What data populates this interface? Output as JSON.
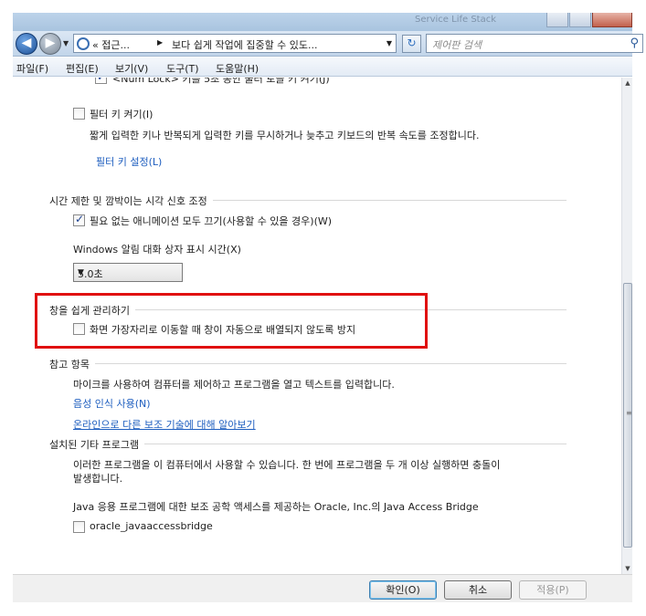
{
  "titlebar": {
    "title": "Service Life Stack"
  },
  "nav": {
    "back_icon": "back-arrow-icon",
    "forward_icon": "forward-arrow-icon",
    "address": {
      "crumb_1": "« 접근...",
      "crumb_2": "보다 쉽게 작업에 집중할 수 있도...",
      "separator": "▶",
      "dropdown": "▼"
    },
    "refresh_glyph": "↻",
    "search_placeholder": "제어판 검색",
    "search_icon_glyph": "⚲"
  },
  "menu": [
    "파일(F)",
    "편집(E)",
    "보기(V)",
    "도구(T)",
    "도움말(H)"
  ],
  "content": {
    "cut_item": "<Num Lock> 키를 5초 동안 눌러 토글 키 켜기(J)",
    "filter_keys": {
      "label": "필터 키 켜기(I)",
      "checked": false,
      "description": "짧게 입력한 키나 반복되게 입력한 키를 무시하거나 늦추고 키보드의 반복 속도를 조정합니다.",
      "settings_link": "필터 키 설정(L)"
    },
    "timing_section": {
      "title": "시간 제한 및 깜박이는 시각 신호 조정",
      "animations_label": "필요 없는 애니메이션 모두 끄기(사용할 수 있을 경우)(W)",
      "animations_checked": true,
      "notify_label": "Windows 알림 대화 상자 표시 시간(X)",
      "notify_value": "5.0초"
    },
    "window_section": {
      "title": "창을 쉽게 관리하기",
      "snap_label": "화면 가장자리로 이동할 때 창이 자동으로 배열되지 않도록 방지",
      "snap_checked": false
    },
    "see_also": {
      "title": "참고 항목",
      "description": "마이크를 사용하여 컴퓨터를 제어하고 프로그램을 열고 텍스트를 입력합니다.",
      "speech_link": "음성 인식 사용(N)",
      "online_link": "온라인으로 다른 보조 기술에 대해 알아보기"
    },
    "installed": {
      "title": "설치된 기타 프로그램",
      "description_1": "이러한 프로그램을 이 컴퓨터에서 사용할 수 있습니다. 한 번에 프로그램을 두 개 이상 실행하면 충돌이",
      "description_2": "발생합니다.",
      "java_text": "Java 응용 프로그램에 대한 보조 공학 액세스를 제공하는 Oracle, Inc.의 Java Access Bridge",
      "java_checkbox_label": "oracle_javaaccessbridge",
      "java_checked": false
    }
  },
  "buttons": {
    "ok": "확인(O)",
    "cancel": "취소",
    "apply": "적용(P)"
  },
  "colors": {
    "highlight": "#e01010",
    "link": "#1e5ebf"
  }
}
